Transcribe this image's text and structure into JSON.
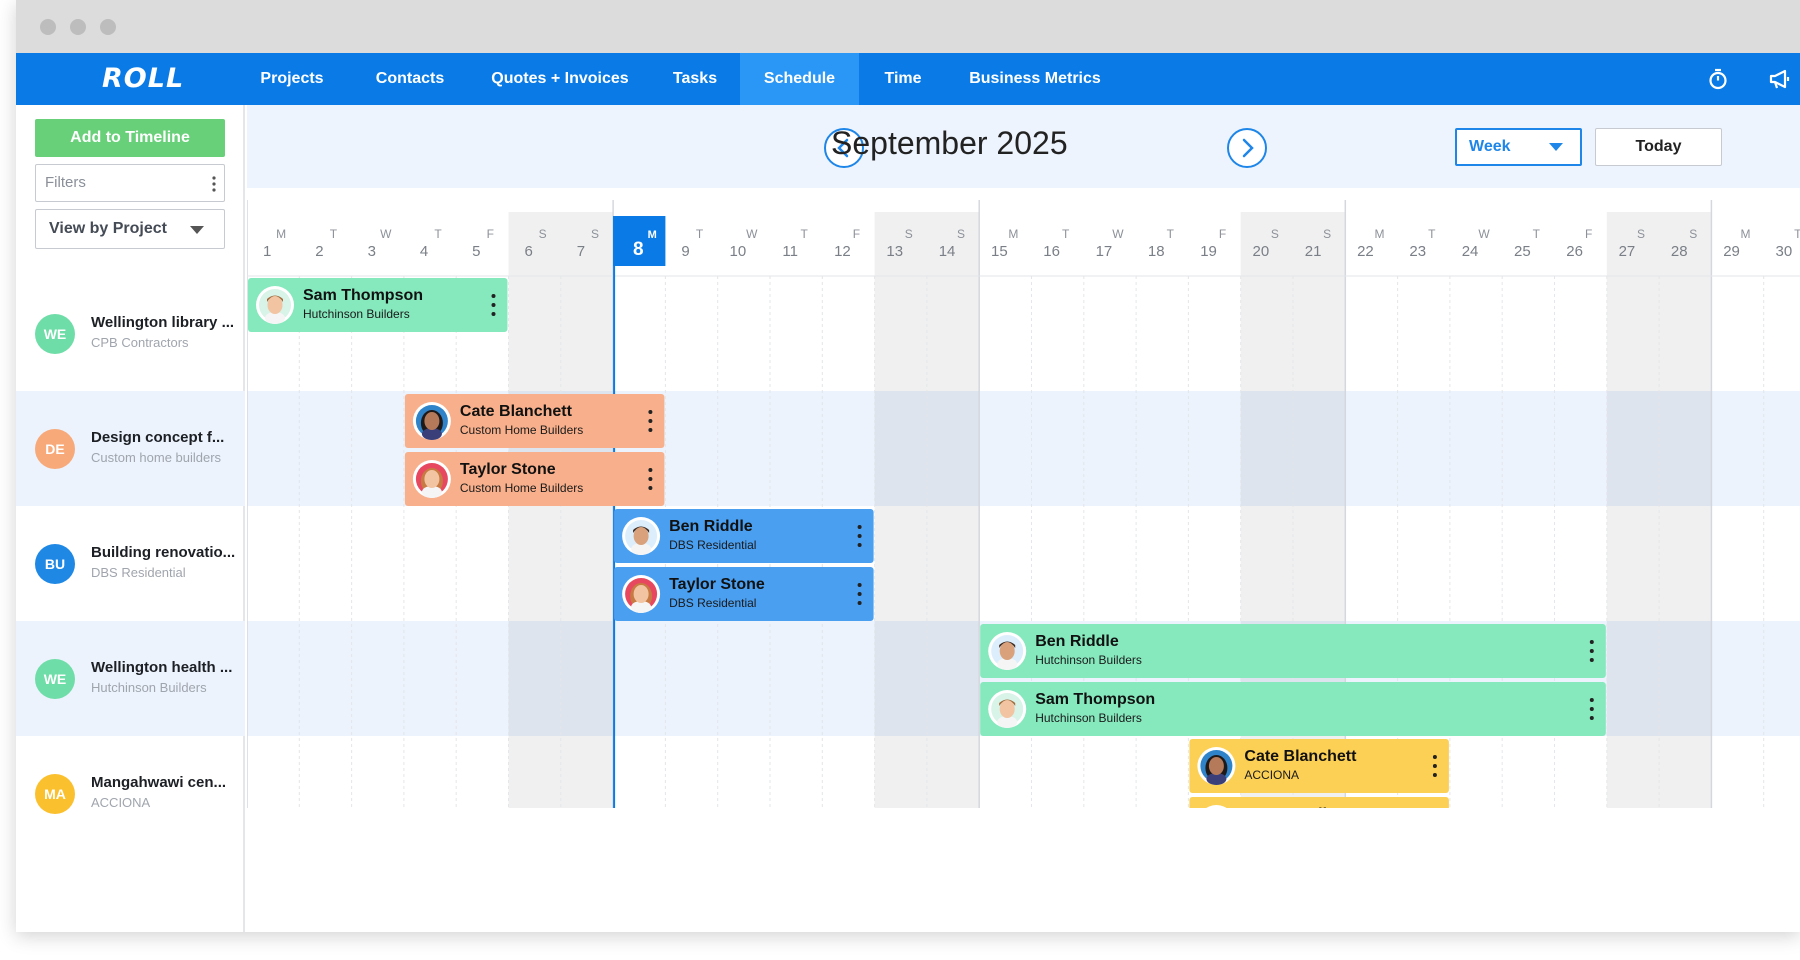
{
  "nav": {
    "logo": "ROLL",
    "items": [
      "Projects",
      "Contacts",
      "Quotes + Invoices",
      "Tasks",
      "Schedule",
      "Time",
      "Business Metrics"
    ],
    "active": "Schedule",
    "icons": [
      "stopwatch-icon",
      "megaphone-icon"
    ]
  },
  "sidebar": {
    "add_button": "Add to Timeline",
    "filters_placeholder": "Filters",
    "view_by": "View by Project"
  },
  "header": {
    "month": "September 2025",
    "range_select": "Week",
    "today_button": "Today"
  },
  "calendar": {
    "today": 8,
    "days": [
      {
        "l": "M",
        "d": "1"
      },
      {
        "l": "T",
        "d": "2"
      },
      {
        "l": "W",
        "d": "3"
      },
      {
        "l": "T",
        "d": "4"
      },
      {
        "l": "F",
        "d": "5"
      },
      {
        "l": "S",
        "d": "6"
      },
      {
        "l": "S",
        "d": "7"
      },
      {
        "l": "M",
        "d": "8"
      },
      {
        "l": "T",
        "d": "9"
      },
      {
        "l": "W",
        "d": "10"
      },
      {
        "l": "T",
        "d": "11"
      },
      {
        "l": "F",
        "d": "12"
      },
      {
        "l": "S",
        "d": "13"
      },
      {
        "l": "S",
        "d": "14"
      },
      {
        "l": "M",
        "d": "15"
      },
      {
        "l": "T",
        "d": "16"
      },
      {
        "l": "W",
        "d": "17"
      },
      {
        "l": "T",
        "d": "18"
      },
      {
        "l": "F",
        "d": "19"
      },
      {
        "l": "S",
        "d": "20"
      },
      {
        "l": "S",
        "d": "21"
      },
      {
        "l": "M",
        "d": "22"
      },
      {
        "l": "T",
        "d": "23"
      },
      {
        "l": "W",
        "d": "24"
      },
      {
        "l": "T",
        "d": "25"
      },
      {
        "l": "F",
        "d": "26"
      },
      {
        "l": "S",
        "d": "27"
      },
      {
        "l": "S",
        "d": "28"
      },
      {
        "l": "M",
        "d": "29"
      },
      {
        "l": "T",
        "d": "30"
      }
    ]
  },
  "projects": [
    {
      "initials": "WE",
      "name": "Wellington library ...",
      "client": "CPB Contractors",
      "color": "#6fdda8"
    },
    {
      "initials": "DE",
      "name": "Design concept f...",
      "client": "Custom home builders",
      "color": "#f7a97a"
    },
    {
      "initials": "BU",
      "name": "Building renovatio...",
      "client": "DBS Residential",
      "color": "#1f88e5"
    },
    {
      "initials": "WE",
      "name": "Wellington health ...",
      "client": "Hutchinson Builders",
      "color": "#6fdda8"
    },
    {
      "initials": "MA",
      "name": "Mangahwawi cen...",
      "client": "ACCIONA",
      "color": "#fbc02d"
    }
  ],
  "bookings": [
    {
      "project": 0,
      "start": 1,
      "end": 5,
      "name": "Sam Thompson",
      "company": "Hutchinson Builders",
      "color": "#86e8bd",
      "avatar": "man"
    },
    {
      "project": 1,
      "start": 4,
      "end": 8,
      "name": "Cate Blanchett",
      "company": "Custom Home Builders",
      "color": "#f8b08c",
      "avatar": "woman-dark"
    },
    {
      "project": 1,
      "start": 4,
      "end": 8,
      "name": "Taylor Stone",
      "company": "Custom Home Builders",
      "color": "#f8b08c",
      "avatar": "woman-red"
    },
    {
      "project": 2,
      "start": 8,
      "end": 12,
      "name": "Ben Riddle",
      "company": "DBS Residential",
      "color": "#4a9ff0",
      "avatar": "man-dark"
    },
    {
      "project": 2,
      "start": 8,
      "end": 12,
      "name": "Taylor Stone",
      "company": "DBS Residential",
      "color": "#4a9ff0",
      "avatar": "woman-red"
    },
    {
      "project": 3,
      "start": 15,
      "end": 26,
      "name": "Ben Riddle",
      "company": "Hutchinson Builders",
      "color": "#86e8bd",
      "avatar": "man-dark"
    },
    {
      "project": 3,
      "start": 15,
      "end": 26,
      "name": "Sam Thompson",
      "company": "Hutchinson Builders",
      "color": "#86e8bd",
      "avatar": "man"
    },
    {
      "project": 4,
      "start": 19,
      "end": 23,
      "name": "Cate Blanchett",
      "company": "ACCIONA",
      "color": "#fcd055",
      "avatar": "woman-dark"
    },
    {
      "project": 4,
      "start": 19,
      "end": 23,
      "name": "Susan Collette",
      "company": "ACCIONA",
      "color": "#fcd055",
      "avatar": "woman-red"
    }
  ]
}
